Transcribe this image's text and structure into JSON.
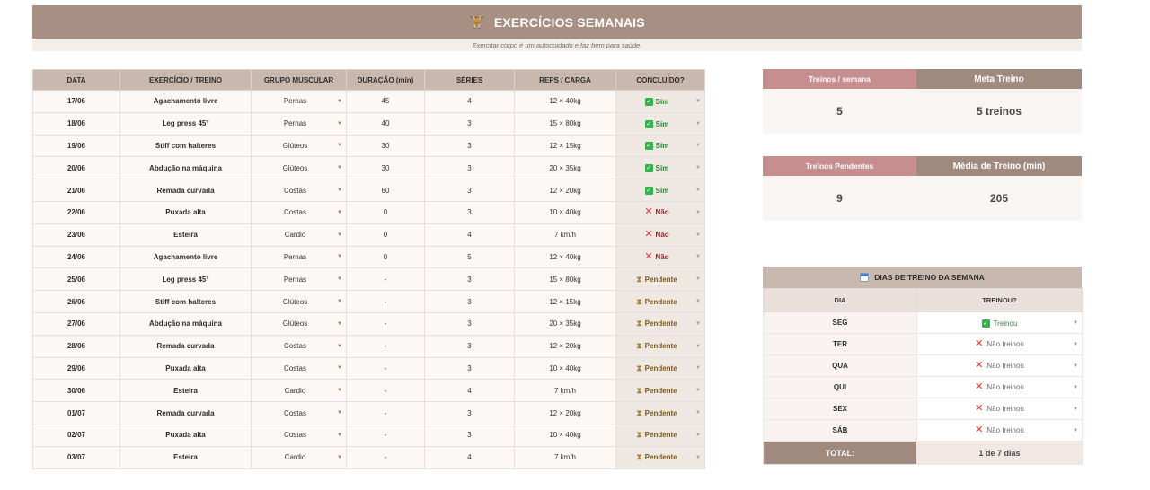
{
  "header": {
    "title": "EXERCÍCIOS SEMANAIS",
    "icon": "dumbbell-icon",
    "subtitle": "Exercitar corpo é um autocuidado e faz bem para saúde."
  },
  "table": {
    "columns": [
      "DATA",
      "EXERCÍCIO / TREINO",
      "GRUPO MUSCULAR",
      "DURAÇÃO (min)",
      "SÉRIES",
      "REPS / CARGA",
      "CONCLUÍDO?"
    ],
    "rows": [
      {
        "date": "17/06",
        "exercise": "Agachamento livre",
        "group": "Pernas",
        "duration": "45",
        "series": "4",
        "reps": "12 × 40kg",
        "status": "sim",
        "status_label": "Sim"
      },
      {
        "date": "18/06",
        "exercise": "Leg press 45°",
        "group": "Pernas",
        "duration": "40",
        "series": "3",
        "reps": "15 × 80kg",
        "status": "sim",
        "status_label": "Sim"
      },
      {
        "date": "19/06",
        "exercise": "Stiff com halteres",
        "group": "Glúteos",
        "duration": "30",
        "series": "3",
        "reps": "12 × 15kg",
        "status": "sim",
        "status_label": "Sim"
      },
      {
        "date": "20/06",
        "exercise": "Abdução na máquina",
        "group": "Glúteos",
        "duration": "30",
        "series": "3",
        "reps": "20 × 35kg",
        "status": "sim",
        "status_label": "Sim"
      },
      {
        "date": "21/06",
        "exercise": "Remada curvada",
        "group": "Costas",
        "duration": "60",
        "series": "3",
        "reps": "12 × 20kg",
        "status": "sim",
        "status_label": "Sim"
      },
      {
        "date": "22/06",
        "exercise": "Puxada alta",
        "group": "Costas",
        "duration": "0",
        "series": "3",
        "reps": "10 × 40kg",
        "status": "nao",
        "status_label": "Não"
      },
      {
        "date": "23/06",
        "exercise": "Esteira",
        "group": "Cardio",
        "duration": "0",
        "series": "4",
        "reps": "7 km/h",
        "status": "nao",
        "status_label": "Não"
      },
      {
        "date": "24/06",
        "exercise": "Agachamento livre",
        "group": "Pernas",
        "duration": "0",
        "series": "5",
        "reps": "12 × 40kg",
        "status": "nao",
        "status_label": "Não"
      },
      {
        "date": "25/06",
        "exercise": "Leg press 45°",
        "group": "Pernas",
        "duration": "-",
        "series": "3",
        "reps": "15 × 80kg",
        "status": "pend",
        "status_label": "Pendente"
      },
      {
        "date": "26/06",
        "exercise": "Stiff com halteres",
        "group": "Glúteos",
        "duration": "-",
        "series": "3",
        "reps": "12 × 15kg",
        "status": "pend",
        "status_label": "Pendente"
      },
      {
        "date": "27/06",
        "exercise": "Abdução na máquina",
        "group": "Glúteos",
        "duration": "-",
        "series": "3",
        "reps": "20 × 35kg",
        "status": "pend",
        "status_label": "Pendente"
      },
      {
        "date": "28/06",
        "exercise": "Remada curvada",
        "group": "Costas",
        "duration": "-",
        "series": "3",
        "reps": "12 × 20kg",
        "status": "pend",
        "status_label": "Pendente"
      },
      {
        "date": "29/06",
        "exercise": "Puxada alta",
        "group": "Costas",
        "duration": "-",
        "series": "3",
        "reps": "10 × 40kg",
        "status": "pend",
        "status_label": "Pendente"
      },
      {
        "date": "30/06",
        "exercise": "Esteira",
        "group": "Cardio",
        "duration": "-",
        "series": "4",
        "reps": "7 km/h",
        "status": "pend",
        "status_label": "Pendente"
      },
      {
        "date": "01/07",
        "exercise": "Remada curvada",
        "group": "Costas",
        "duration": "-",
        "series": "3",
        "reps": "12 × 20kg",
        "status": "pend",
        "status_label": "Pendente"
      },
      {
        "date": "02/07",
        "exercise": "Puxada alta",
        "group": "Costas",
        "duration": "-",
        "series": "3",
        "reps": "10 × 40kg",
        "status": "pend",
        "status_label": "Pendente"
      },
      {
        "date": "03/07",
        "exercise": "Esteira",
        "group": "Cardio",
        "duration": "-",
        "series": "4",
        "reps": "7 km/h",
        "status": "pend",
        "status_label": "Pendente"
      }
    ]
  },
  "stats": {
    "treinos_semana": {
      "label": "Treinos / semana",
      "value": "5"
    },
    "meta_treino": {
      "label": "Meta Treino",
      "value": "5 treinos"
    },
    "treinos_pendentes": {
      "label": "Treinos Pendentes",
      "value": "9"
    },
    "media_treino": {
      "label": "Média de Treino (min)",
      "value": "205"
    }
  },
  "days": {
    "title": "DIAS DE TREINO DA SEMANA",
    "icon": "calendar-icon",
    "col_day": "DIA",
    "col_status": "TREINOU?",
    "rows": [
      {
        "day": "SEG",
        "status": "ok",
        "label": "Treinou"
      },
      {
        "day": "TER",
        "status": "no",
        "label": "Não treinou"
      },
      {
        "day": "QUA",
        "status": "no",
        "label": "Não treinou"
      },
      {
        "day": "QUI",
        "status": "no",
        "label": "Não treinou"
      },
      {
        "day": "SEX",
        "status": "no",
        "label": "Não treinou"
      },
      {
        "day": "SÁB",
        "status": "no",
        "label": "Não treinou"
      }
    ],
    "total_label": "TOTAL:",
    "total_value": "1 de 7 dias"
  },
  "colors": {
    "header_bg": "#a88f84",
    "table_header_bg": "#c9b8ae",
    "rose_header": "#c78e90",
    "taupe_header": "#a08a80",
    "check_green": "#33b24a",
    "cross_red": "#e53935"
  }
}
